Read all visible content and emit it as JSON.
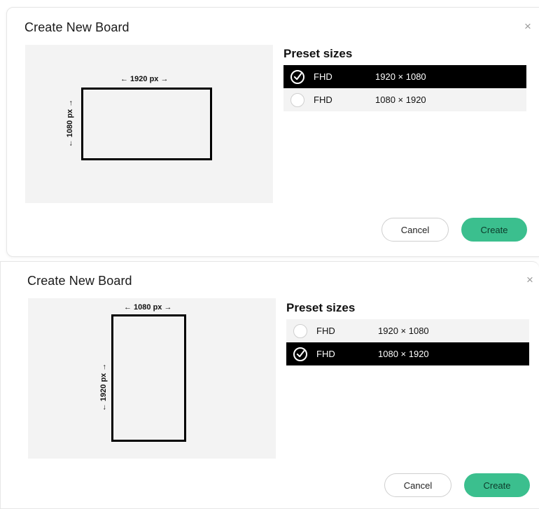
{
  "dialogs": [
    {
      "title": "Create New Board",
      "close_icon": "×",
      "preview": {
        "width_label": "← 1920 px →",
        "height_label": "← 1080 px →"
      },
      "preset_title": "Preset sizes",
      "presets": [
        {
          "name": "FHD",
          "dims": "1920 × 1080",
          "selected": true
        },
        {
          "name": "FHD",
          "dims": "1080 × 1920",
          "selected": false
        }
      ],
      "cancel_label": "Cancel",
      "create_label": "Create"
    },
    {
      "title": "Create New Board",
      "close_icon": "×",
      "preview": {
        "width_label": "← 1080 px →",
        "height_label": "← 1920 px →"
      },
      "preset_title": "Preset sizes",
      "presets": [
        {
          "name": "FHD",
          "dims": "1920 × 1080",
          "selected": false
        },
        {
          "name": "FHD",
          "dims": "1080 × 1920",
          "selected": true
        }
      ],
      "cancel_label": "Cancel",
      "create_label": "Create"
    }
  ],
  "colors": {
    "create_button": "#3bbf8e",
    "selected_row": "#000000",
    "preview_bg": "#f3f3f3"
  }
}
